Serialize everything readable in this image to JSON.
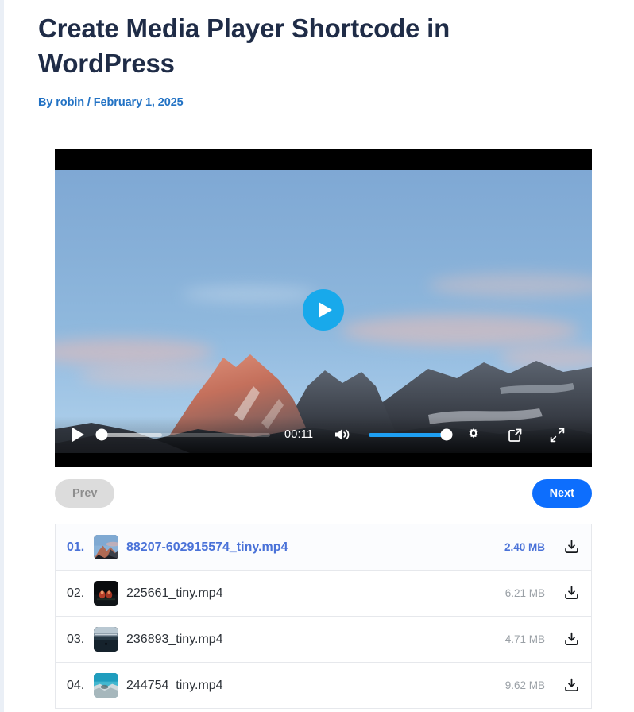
{
  "post": {
    "title": "Create Media Player Shortcode in WordPress",
    "byline": "By robin / February 1, 2025"
  },
  "player": {
    "current_time": "00:11",
    "play_overlay_label": "Play",
    "progress_percent": 0,
    "buffered_percent": 36,
    "volume_percent": 100,
    "accent_color": "#18a9eb",
    "volume_color": "#1e9ff2",
    "icons": {
      "play": "play-icon",
      "volume": "volume-high-icon",
      "settings": "gear-icon",
      "pip": "picture-in-picture-icon",
      "fullscreen": "fullscreen-icon"
    }
  },
  "pagination": {
    "prev_label": "Prev",
    "next_label": "Next",
    "prev_disabled": true,
    "next_color": "#0d6efd",
    "prev_color": "#dcdcdc"
  },
  "playlist": {
    "active_index": 0,
    "active_color": "#4a72d8",
    "items": [
      {
        "index": "01.",
        "name": "88207-602915574_tiny.mp4",
        "size": "2.40 MB",
        "thumb": "mountain-sunset-thumbnail",
        "download_icon": "download-icon",
        "active": true
      },
      {
        "index": "02.",
        "name": "225661_tiny.mp4",
        "size": "6.21 MB",
        "thumb": "night-lights-thumbnail",
        "download_icon": "download-icon",
        "active": false
      },
      {
        "index": "03.",
        "name": "236893_tiny.mp4",
        "size": "4.71 MB",
        "thumb": "dark-lake-thumbnail",
        "download_icon": "download-icon",
        "active": false
      },
      {
        "index": "04.",
        "name": "244754_tiny.mp4",
        "size": "9.62 MB",
        "thumb": "turquoise-reef-thumbnail",
        "download_icon": "download-icon",
        "active": false
      }
    ]
  }
}
